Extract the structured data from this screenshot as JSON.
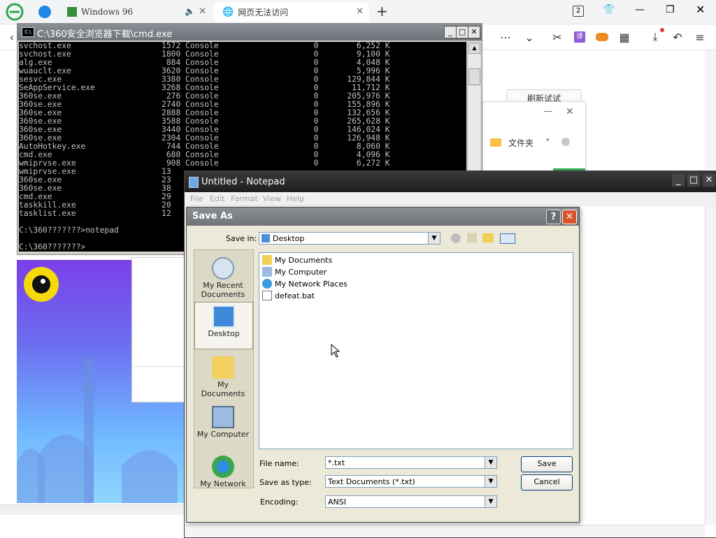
{
  "browser": {
    "tabs": [
      {
        "label": "Windows 96"
      },
      {
        "label": "网页无法访问"
      }
    ],
    "tab_counter": "2",
    "new_tab": "+",
    "page_button": "刷新试试",
    "download_panel": {
      "folder_label": "文件夹"
    }
  },
  "cmd": {
    "title": "C:\\360安全浏览器下载\\cmd.exe",
    "lines": [
      "svchost.exe                   1572 Console                    0        6,252 K",
      "svchost.exe                   1800 Console                    0        9,100 K",
      "alg.exe                        884 Console                    0        4,048 K",
      "wuauclt.exe                   3620 Console                    0        5,996 K",
      "sesvc.exe                     3380 Console                    0      129,844 K",
      "SeAppService.exe              3268 Console                    0       11,712 K",
      "360se.exe                      276 Console                    0      205,976 K",
      "360se.exe                     2740 Console                    0      155,896 K",
      "360se.exe                     2888 Console                    0      132,656 K",
      "360se.exe                     3588 Console                    0      265,628 K",
      "360se.exe                     3440 Console                    0      146,024 K",
      "360se.exe                     2304 Console                    0      126,948 K",
      "AutoHotkey.exe                 744 Console                    0        8,060 K",
      "cmd.exe                        680 Console                    0        4,096 K",
      "wmiprvse.exe                   908 Console                    0        6,272 K",
      "wmiprvse.exe                  13",
      "360se.exe                     23",
      "360se.exe                     38",
      "cmd.exe                       29",
      "taskkill.exe                  20",
      "tasklist.exe                  12",
      "",
      "C:\\360???????>notepad",
      "",
      "C:\\360???????>"
    ]
  },
  "notepad": {
    "title": "Untitled - Notepad",
    "menu": [
      "File",
      "Edit",
      "Format",
      "View",
      "Help"
    ]
  },
  "saveas": {
    "title": "Save As",
    "help": "?",
    "save_in_label": "Save in:",
    "save_in_value": "Desktop",
    "places": [
      {
        "label": "My Recent Documents",
        "icon": "recent-documents-icon"
      },
      {
        "label": "Desktop",
        "icon": "desktop-icon"
      },
      {
        "label": "My Documents",
        "icon": "my-documents-icon"
      },
      {
        "label": "My Computer",
        "icon": "my-computer-icon"
      },
      {
        "label": "My Network",
        "icon": "my-network-icon"
      }
    ],
    "files": [
      {
        "label": "My Documents",
        "icon": "folder-icon"
      },
      {
        "label": "My Computer",
        "icon": "computer-icon"
      },
      {
        "label": "My Network Places",
        "icon": "network-icon"
      },
      {
        "label": "defeat.bat",
        "icon": "batch-file-icon"
      }
    ],
    "file_name_label": "File name:",
    "file_name_value": "*.txt",
    "save_type_label": "Save as type:",
    "save_type_value": "Text Documents (*.txt)",
    "encoding_label": "Encoding:",
    "encoding_value": "ANSI",
    "save_button": "Save",
    "cancel_button": "Cancel"
  },
  "colors": {
    "browser_accent": "#2fa84f",
    "cmd_bg": "#000000",
    "cmd_text": "#c0c0c0",
    "dialog_bg": "#ece9d8",
    "close_red": "#d9532c"
  }
}
